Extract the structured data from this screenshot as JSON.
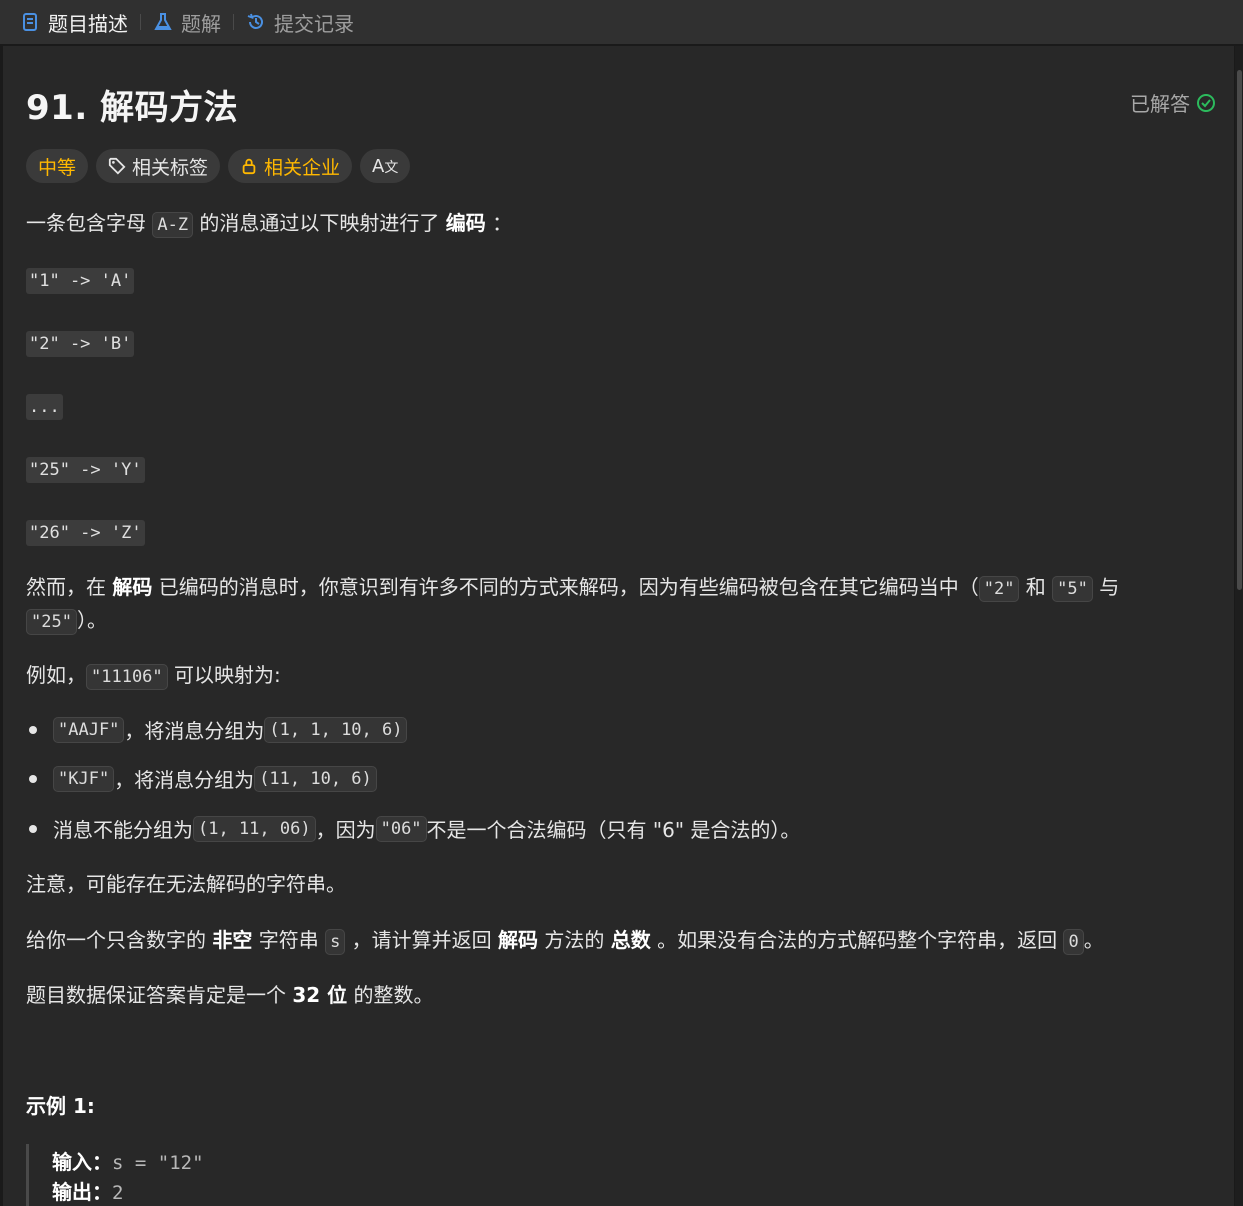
{
  "tabs": [
    {
      "label": "题目描述",
      "icon": "document-icon"
    },
    {
      "label": "题解",
      "icon": "flask-icon"
    },
    {
      "label": "提交记录",
      "icon": "history-icon"
    }
  ],
  "problem": {
    "title": "91. 解码方法",
    "status": "已解答",
    "tags": {
      "difficulty": "中等",
      "related_tags": "相关标签",
      "related_companies": "相关企业",
      "translate": "A"
    }
  },
  "desc": {
    "intro_a": "一条包含字母 ",
    "intro_code": "A-Z",
    "intro_b": " 的消息通过以下映射进行了 ",
    "intro_bold": "编码",
    "intro_c": " ：",
    "mapping": [
      "\"1\" -> 'A'",
      "\"2\" -> 'B'",
      "...",
      "\"25\" -> 'Y'",
      "\"26\" -> 'Z'"
    ],
    "p2_a": "然而，在 ",
    "p2_bold": "解码",
    "p2_b": " 已编码的消息时，你意识到有许多不同的方式来解码，因为有些编码被包含在其它编码当中（",
    "p2_code1": "\"2\"",
    "p2_c": " 和 ",
    "p2_code2": "\"5\"",
    "p2_d": " 与",
    "p2_code3": "\"25\"",
    "p2_e": "）。",
    "p3_a": "例如，",
    "p3_code": "\"11106\"",
    "p3_b": " 可以映射为:",
    "bullets": [
      {
        "code1": "\"AAJF\"",
        "text": " ，将消息分组为 ",
        "code2": "(1, 1, 10, 6)",
        "tail": ""
      },
      {
        "code1": "\"KJF\"",
        "text": " ，将消息分组为 ",
        "code2": "(11, 10, 6)",
        "tail": ""
      }
    ],
    "b3_a": "消息不能分组为  ",
    "b3_code1": "(1, 11, 06)",
    "b3_b": " ，因为 ",
    "b3_code2": "\"06\"",
    "b3_c": " 不是一个合法编码（只有 \"6\" 是合法的）。",
    "p4": "注意，可能存在无法解码的字符串。",
    "p5_a": "给你一个只含数字的 ",
    "p5_bold1": "非空",
    "p5_b": " 字符串 ",
    "p5_code1": "s",
    "p5_c": " ，请计算并返回 ",
    "p5_bold2": "解码",
    "p5_d": " 方法的 ",
    "p5_bold3": "总数",
    "p5_e": " 。如果没有合法的方式解码整个字符串，返回 ",
    "p5_code2": "0",
    "p5_f": "。",
    "p6_a": "题目数据保证答案肯定是一个 ",
    "p6_bold": "32 位",
    "p6_b": " 的整数。",
    "example_title": "示例 1:",
    "ex_input_label": "输入：",
    "ex_input_value": "s = \"12\"",
    "ex_output_label": "输出：",
    "ex_output_value": "2"
  },
  "colors": {
    "medium": "#ffb800",
    "solved_check": "#2cbb5d",
    "tab_icon_blue": "#4a90e2"
  }
}
